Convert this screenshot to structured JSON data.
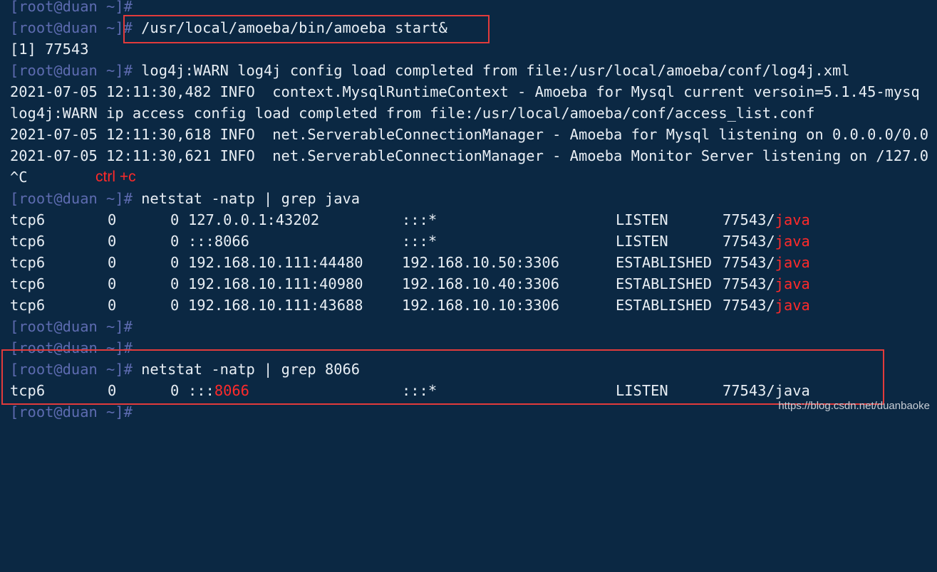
{
  "terminal": {
    "prompt": "[root@duan ~]#",
    "lines": [
      {
        "cmd": ""
      },
      {
        "cmd": " /usr/local/amoeba/bin/amoeba start&"
      },
      {
        "output": "[1] 77543"
      },
      {
        "cmd": " log4j:WARN log4j config load completed from file:/usr/local/amoeba/conf/log4j.xml"
      },
      {
        "output": "2021-07-05 12:11:30,482 INFO  context.MysqlRuntimeContext - Amoeba for Mysql current versoin=5.1.45-mysq"
      },
      {
        "output": "log4j:WARN ip access config load completed from file:/usr/local/amoeba/conf/access_list.conf"
      },
      {
        "output": "2021-07-05 12:11:30,618 INFO  net.ServerableConnectionManager - Amoeba for Mysql listening on 0.0.0.0/0.0"
      },
      {
        "output": "2021-07-05 12:11:30,621 INFO  net.ServerableConnectionManager - Amoeba Monitor Server listening on /127.0"
      },
      {
        "output": "^C"
      },
      {
        "cmd": " netstat -natp | grep java"
      }
    ],
    "netstat_java": [
      {
        "proto": "tcp6",
        "recv": "0",
        "send": "0",
        "local": "127.0.0.1:43202",
        "foreign": ":::*",
        "state": "LISTEN",
        "pid": "77543/",
        "prog": "java"
      },
      {
        "proto": "tcp6",
        "recv": "0",
        "send": "0",
        "local": ":::8066",
        "foreign": ":::*",
        "state": "LISTEN",
        "pid": "77543/",
        "prog": "java"
      },
      {
        "proto": "tcp6",
        "recv": "0",
        "send": "0",
        "local": "192.168.10.111:44480",
        "foreign": "192.168.10.50:3306",
        "state": "ESTABLISHED",
        "pid": "77543/",
        "prog": "java"
      },
      {
        "proto": "tcp6",
        "recv": "0",
        "send": "0",
        "local": "192.168.10.111:40980",
        "foreign": "192.168.10.40:3306",
        "state": "ESTABLISHED",
        "pid": "77543/",
        "prog": "java"
      },
      {
        "proto": "tcp6",
        "recv": "0",
        "send": "0",
        "local": "192.168.10.111:43688",
        "foreign": "192.168.10.10:3306",
        "state": "ESTABLISHED",
        "pid": "77543/",
        "prog": "java"
      }
    ],
    "after_lines": [
      {
        "cmd": ""
      },
      {
        "cmd": ""
      },
      {
        "cmd": " netstat -natp | grep 8066"
      }
    ],
    "netstat_8066": {
      "proto": "tcp6",
      "recv": "0",
      "send": "0",
      "local_prefix": ":::",
      "local_port": "8066",
      "foreign": ":::*",
      "state": "LISTEN",
      "pid": "77543/java"
    },
    "last_cmd": ""
  },
  "annotation": "ctrl +c",
  "watermark": "https://blog.csdn.net/duanbaoke",
  "colors": {
    "background": "#0b2843",
    "prompt": "#5d6bb0",
    "highlight": "#ff2a2a",
    "box": "#e23b3b"
  }
}
